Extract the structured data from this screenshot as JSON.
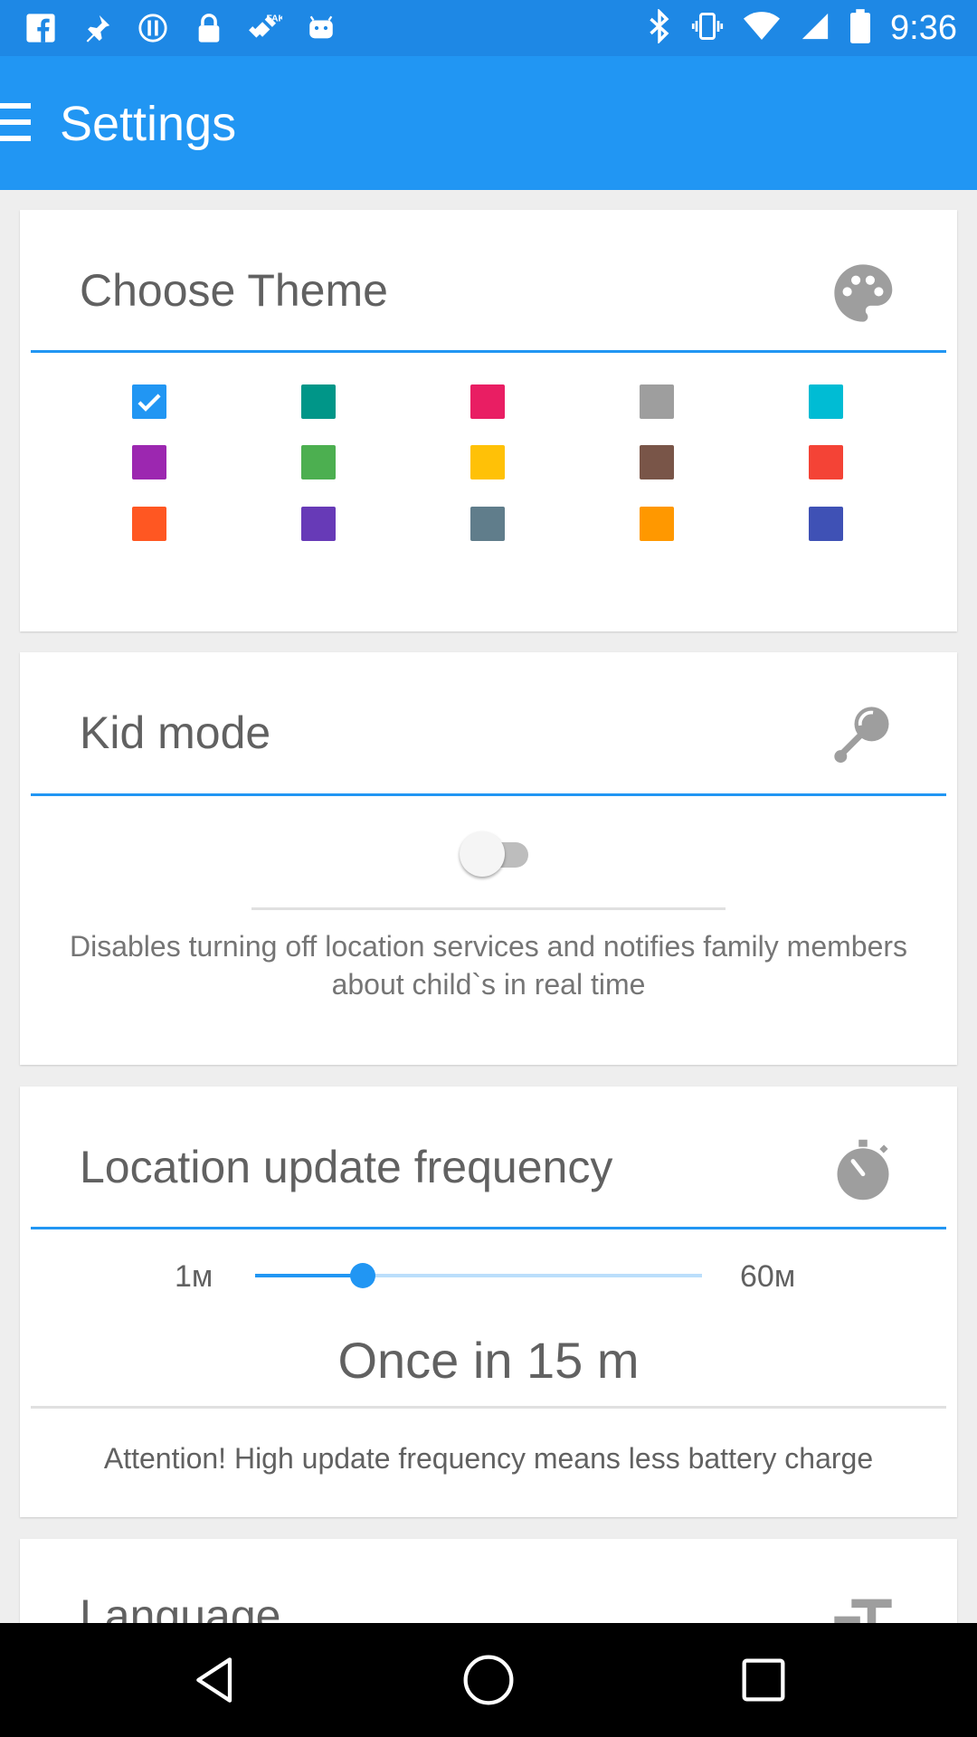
{
  "status_bar": {
    "time": "9:36",
    "left_icons": [
      "facebook-icon",
      "pin-icon",
      "speed-icon",
      "lock-icon",
      "fake-gps-icon",
      "android-icon"
    ],
    "right_icons": [
      "bluetooth-icon",
      "vibrate-icon",
      "wifi-icon",
      "signal-icon",
      "battery-icon"
    ]
  },
  "app_bar": {
    "title": "Settings",
    "menu_icon": "menu-icon"
  },
  "theme_card": {
    "title": "Choose Theme",
    "icon": "palette-icon",
    "swatches": [
      {
        "color": "#2196F3",
        "selected": true
      },
      {
        "color": "#009688",
        "selected": false
      },
      {
        "color": "#E91E63",
        "selected": false
      },
      {
        "color": "#9E9E9E",
        "selected": false
      },
      {
        "color": "#00BCD4",
        "selected": false
      },
      {
        "color": "#9C27B0",
        "selected": false
      },
      {
        "color": "#4CAF50",
        "selected": false
      },
      {
        "color": "#FFC107",
        "selected": false
      },
      {
        "color": "#795548",
        "selected": false
      },
      {
        "color": "#F44336",
        "selected": false
      },
      {
        "color": "#FF5722",
        "selected": false
      },
      {
        "color": "#673AB7",
        "selected": false
      },
      {
        "color": "#607D8B",
        "selected": false
      },
      {
        "color": "#FF9800",
        "selected": false
      },
      {
        "color": "#3F51B5",
        "selected": false
      }
    ]
  },
  "kid_mode_card": {
    "title": "Kid mode",
    "icon": "rattle-icon",
    "toggle_on": false,
    "description": "Disables turning off location services and notifies family members about child`s in real time"
  },
  "location_card": {
    "title": "Location update frequency",
    "icon": "stopwatch-icon",
    "min_label": "1м",
    "max_label": "60м",
    "slider_fraction": 0.24,
    "value_text": "Once in 15 m",
    "attention": "Attention! High update frequency means less battery charge"
  },
  "language_card": {
    "title": "Language",
    "icon": "text-size-icon"
  },
  "nav_bar": {
    "buttons": [
      "back-icon",
      "home-icon",
      "recents-icon"
    ]
  },
  "colors": {
    "accent": "#2196F3",
    "status_bar": "#1E88E5"
  }
}
